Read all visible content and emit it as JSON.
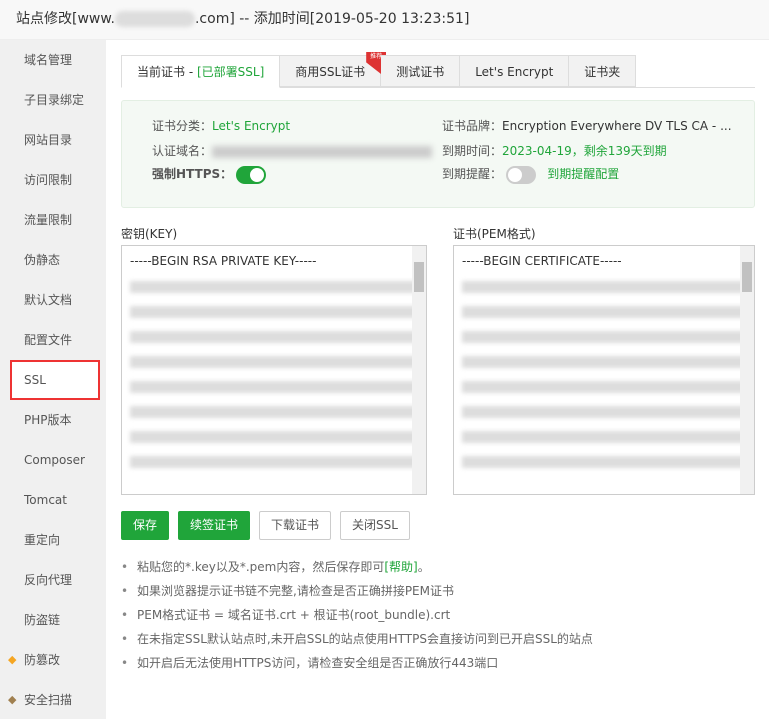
{
  "title": {
    "prefix": "站点修改[www.",
    "suffix": ".com] -- 添加时间[2019-05-20 13:23:51]"
  },
  "sidebar": [
    {
      "label": "域名管理"
    },
    {
      "label": "子目录绑定"
    },
    {
      "label": "网站目录"
    },
    {
      "label": "访问限制"
    },
    {
      "label": "流量限制"
    },
    {
      "label": "伪静态"
    },
    {
      "label": "默认文档"
    },
    {
      "label": "配置文件"
    },
    {
      "label": "SSL",
      "active": true
    },
    {
      "label": "PHP版本"
    },
    {
      "label": "Composer"
    },
    {
      "label": "Tomcat"
    },
    {
      "label": "重定向"
    },
    {
      "label": "反向代理"
    },
    {
      "label": "防盗链"
    },
    {
      "label": "防篡改",
      "icon": "diamond-icon",
      "color": "#f5a623"
    },
    {
      "label": "安全扫描",
      "icon": "diamond-icon",
      "color": "#a08050"
    }
  ],
  "tabs": {
    "current": "当前证书 - ",
    "current_status": "[已部署SSL]",
    "commercial": "商用SSL证书",
    "commercial_badge": "推荐",
    "test": "测试证书",
    "letsencrypt": "Let's Encrypt",
    "folder": "证书夹"
  },
  "info": {
    "type_label": "证书分类：",
    "type_value": "Let's Encrypt",
    "brand_label": "证书品牌：",
    "brand_value": "Encryption Everywhere DV TLS CA - ...",
    "domain_label": "认证域名：",
    "expire_label": "到期时间：",
    "expire_value": "2023-04-19，剩余139天到期",
    "https_label": "强制HTTPS：",
    "https_on": true,
    "remind_label": "到期提醒：",
    "remind_on": false,
    "remind_link": "到期提醒配置"
  },
  "key": {
    "label": "密钥(KEY)",
    "first_line": "-----BEGIN RSA PRIVATE KEY-----"
  },
  "cert": {
    "label": "证书(PEM格式)",
    "first_line": "-----BEGIN CERTIFICATE-----"
  },
  "buttons": {
    "save": "保存",
    "renew": "续签证书",
    "download": "下载证书",
    "close": "关闭SSL"
  },
  "tips": {
    "t1a": "粘贴您的*.key以及*.pem内容，然后保存即可",
    "t1link": "[帮助]",
    "t1b": "。",
    "t2": "如果浏览器提示证书链不完整,请检查是否正确拼接PEM证书",
    "t3": "PEM格式证书 = 域名证书.crt + 根证书(root_bundle).crt",
    "t4": "在未指定SSL默认站点时,未开启SSL的站点使用HTTPS会直接访问到已开启SSL的站点",
    "t5": "如开启后无法使用HTTPS访问，请检查安全组是否正确放行443端口"
  },
  "colors": {
    "accent": "#20a53a",
    "highlight": "#e33333"
  }
}
